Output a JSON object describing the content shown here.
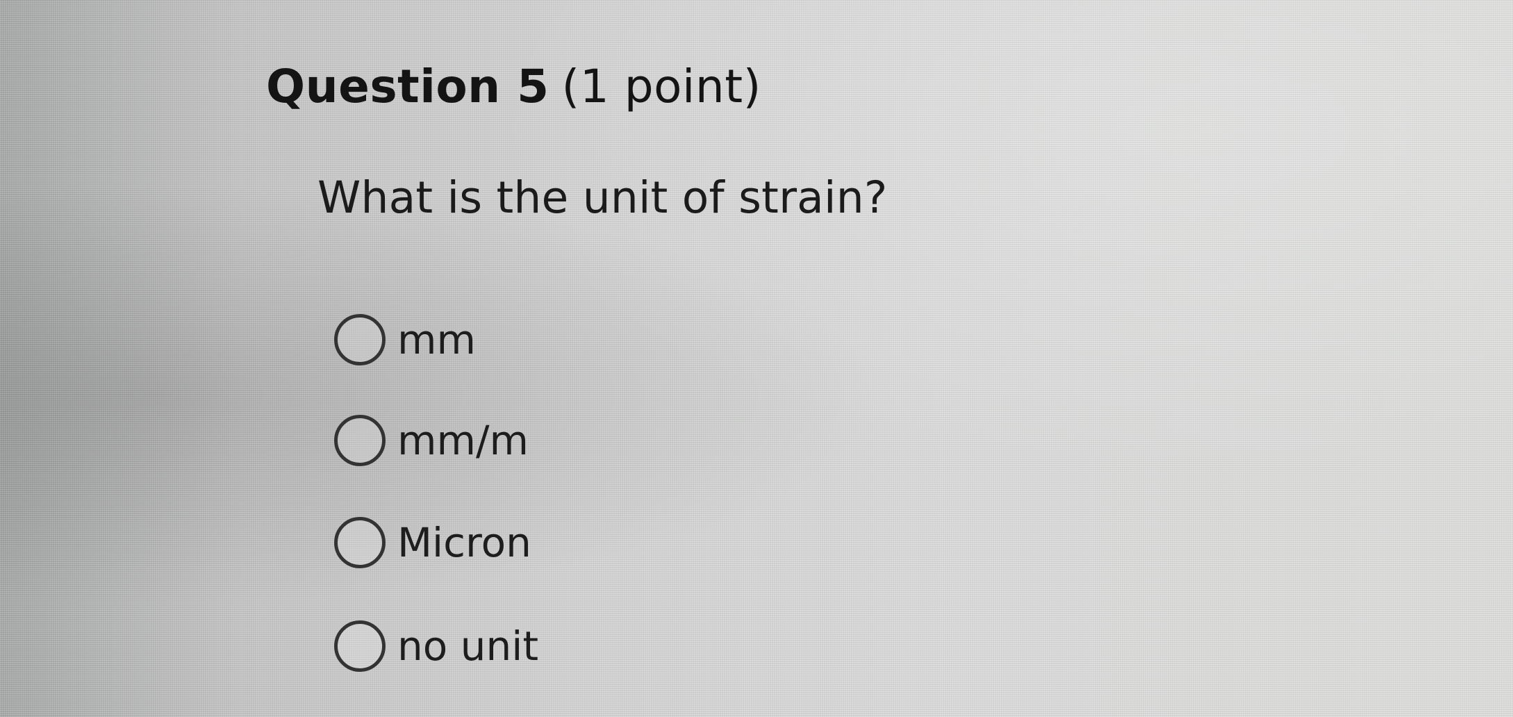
{
  "question": {
    "title": "Question 5",
    "points": "(1 point)",
    "text": "What is the unit of strain?"
  },
  "options": [
    {
      "label": "mm",
      "selected": false
    },
    {
      "label": "mm/m",
      "selected": false
    },
    {
      "label": "Micron",
      "selected": false
    },
    {
      "label": "no unit",
      "selected": false
    }
  ],
  "colors": {
    "text": "#1d1d1d",
    "radio_border": "#333333",
    "background": "#d4d5d4"
  }
}
